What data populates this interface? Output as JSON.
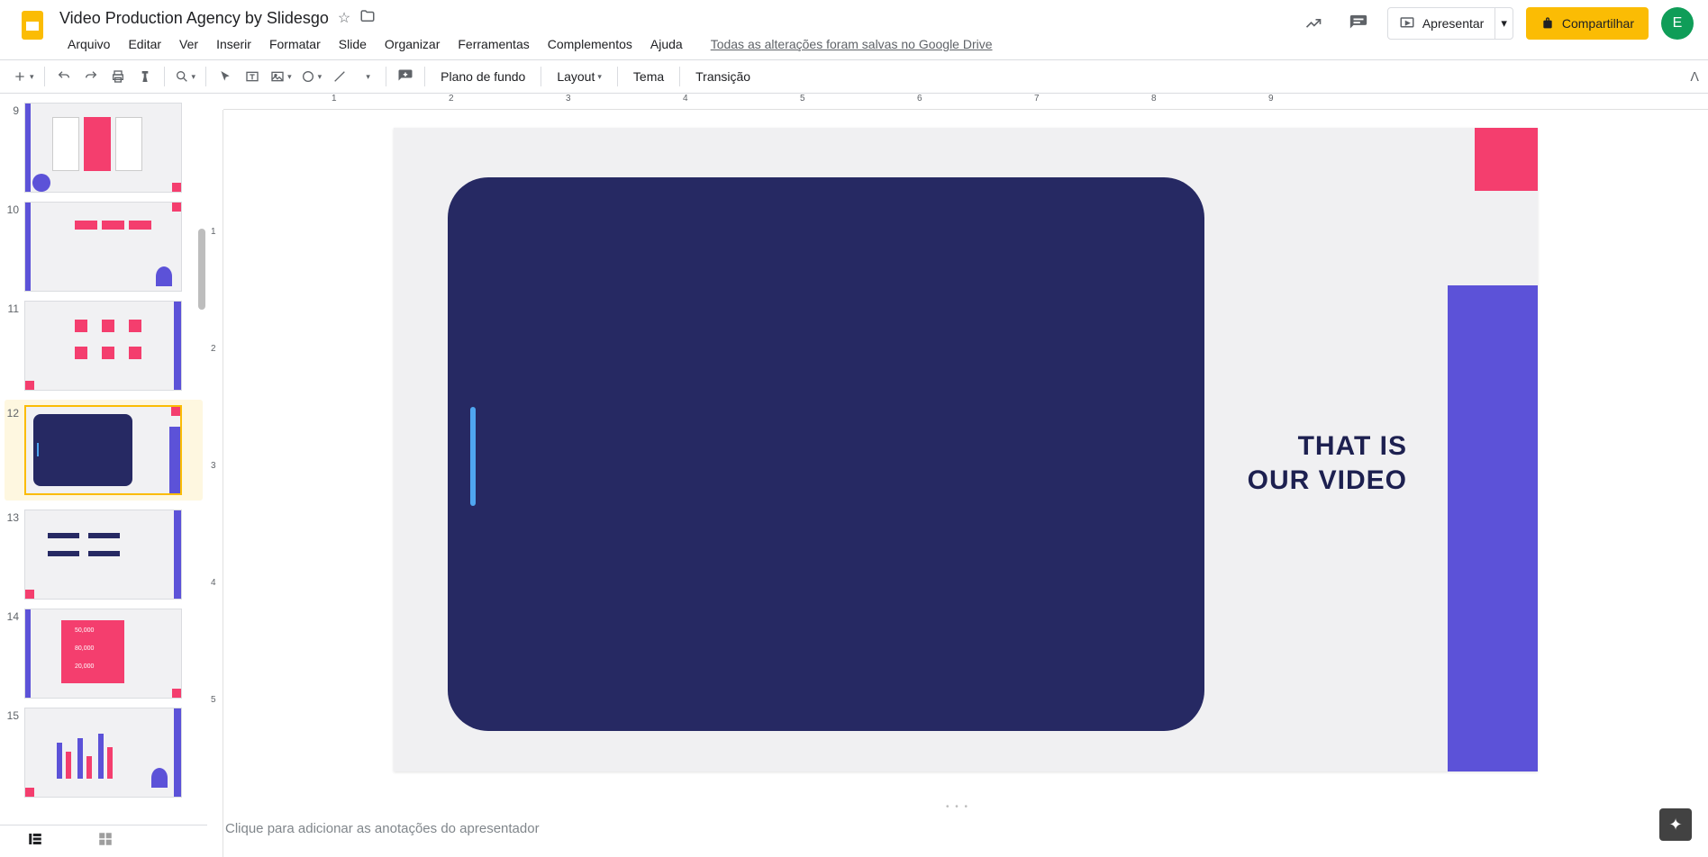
{
  "header": {
    "doc_title": "Video Production Agency by Slidesgo",
    "save_status": "Todas as alterações foram salvas no Google Drive",
    "menus": [
      "Arquivo",
      "Editar",
      "Ver",
      "Inserir",
      "Formatar",
      "Slide",
      "Organizar",
      "Ferramentas",
      "Complementos",
      "Ajuda"
    ],
    "present_label": "Apresentar",
    "share_label": "Compartilhar",
    "avatar_letter": "E"
  },
  "toolbar": {
    "background_label": "Plano de fundo",
    "layout_label": "Layout",
    "theme_label": "Tema",
    "transition_label": "Transição"
  },
  "ruler_h": [
    "1",
    "2",
    "3",
    "4",
    "5",
    "6",
    "7",
    "8",
    "9"
  ],
  "ruler_v": [
    "1",
    "2",
    "3",
    "4",
    "5"
  ],
  "filmstrip": {
    "slides": [
      {
        "num": "9"
      },
      {
        "num": "10"
      },
      {
        "num": "11"
      },
      {
        "num": "12",
        "selected": true
      },
      {
        "num": "13"
      },
      {
        "num": "14"
      },
      {
        "num": "15"
      }
    ]
  },
  "slide": {
    "title_line1": "THAT IS",
    "title_line2": "OUR VIDEO"
  },
  "notes": {
    "placeholder": "Clique para adicionar as anotações do apresentador"
  },
  "colors": {
    "accent_yellow": "#fbbc04",
    "slide_dark": "#262963",
    "slide_purple": "#5c52d8",
    "slide_pink": "#f43e6e"
  }
}
